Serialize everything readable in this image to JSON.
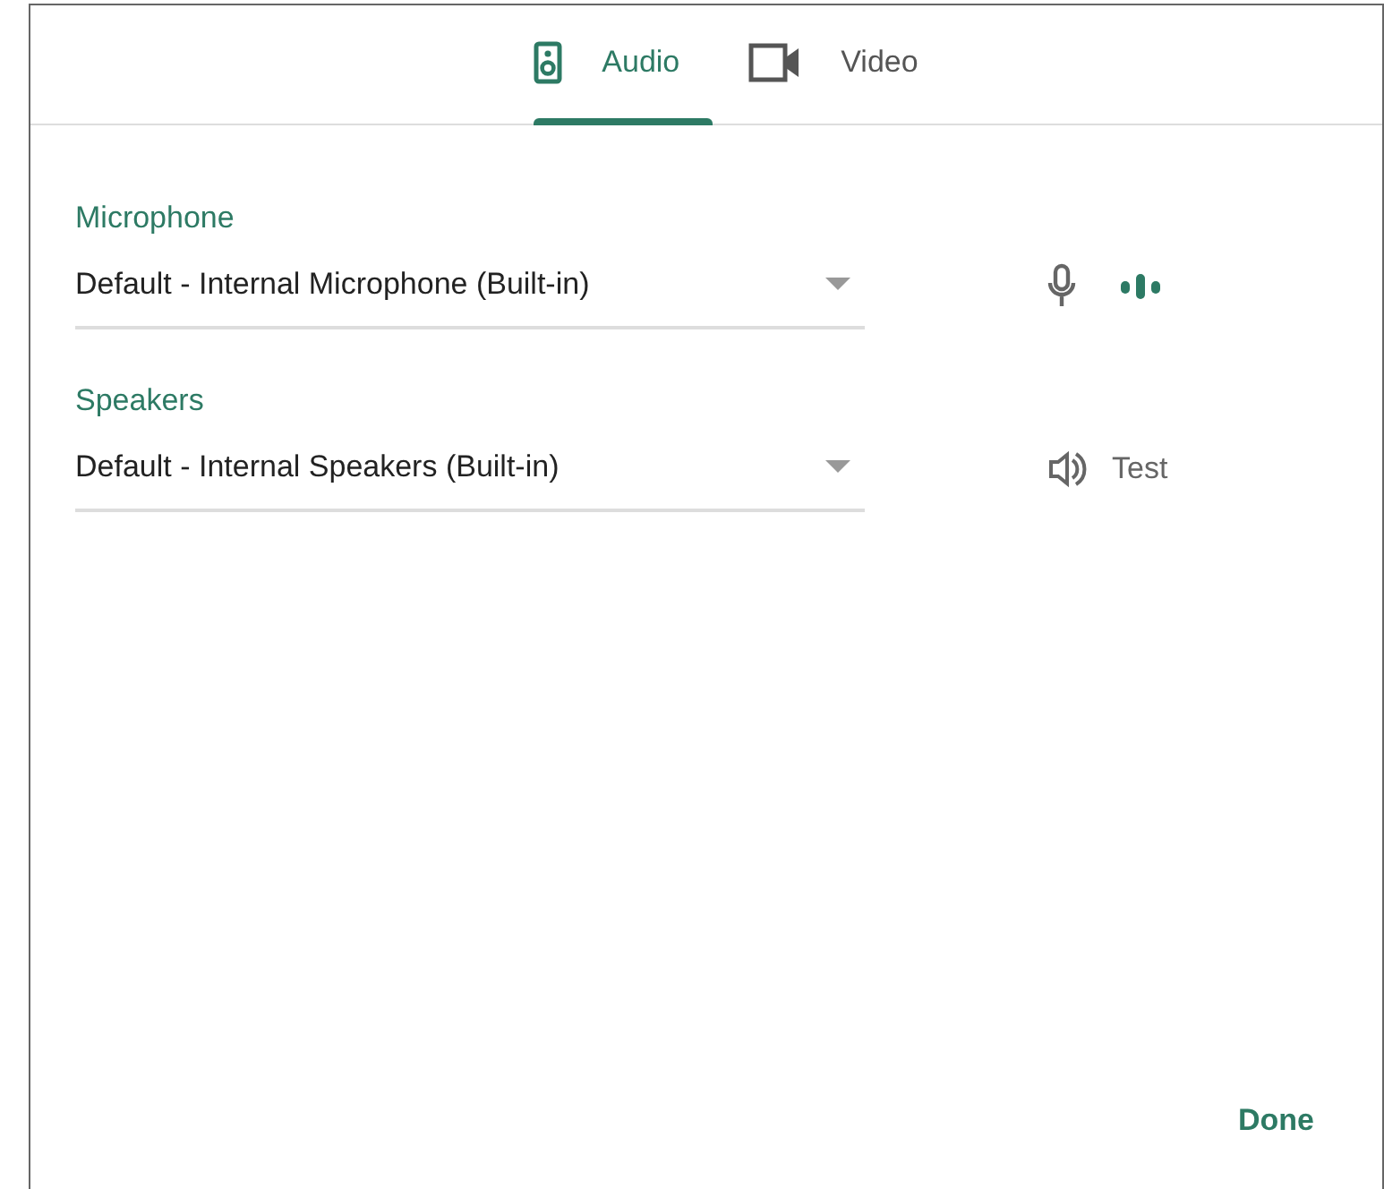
{
  "tabs": [
    {
      "label": "Audio",
      "kind": "speaker",
      "selected": true
    },
    {
      "label": "Video",
      "kind": "camera",
      "selected": false
    }
  ],
  "devices": [
    {
      "kind": "microphone",
      "label": "Microphone",
      "value": "Default - Internal Microphone (Built-in)"
    },
    {
      "kind": "speakers",
      "label": "Speakers",
      "value": "Default - Internal Speakers (Built-in)",
      "action": "Test"
    }
  ],
  "done_button": "Done"
}
